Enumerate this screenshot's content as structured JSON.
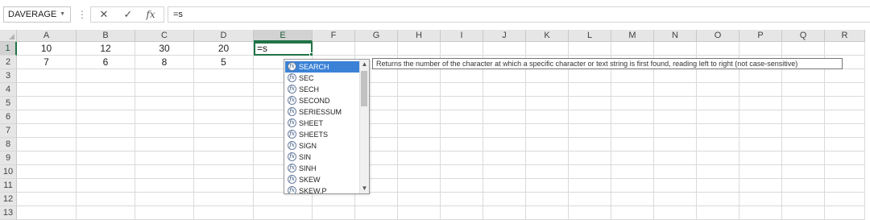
{
  "name_box": {
    "value": "DAVERAGE",
    "dropdown_glyph": "▼"
  },
  "formula_bar": {
    "options_glyph": "⋮",
    "cancel_glyph": "✕",
    "enter_glyph": "✓",
    "fx_glyph": "fx",
    "value": "=s"
  },
  "colors": {
    "accent": "#217346",
    "selection": "#3b82d6"
  },
  "columns": [
    "A",
    "B",
    "C",
    "D",
    "E",
    "F",
    "G",
    "H",
    "I",
    "J",
    "K",
    "L",
    "M",
    "N",
    "O",
    "P",
    "Q",
    "R"
  ],
  "selected_column": "E",
  "selected_row": "1",
  "rows": [
    {
      "label": "1",
      "cells": [
        "10",
        "12",
        "30",
        "20",
        "=s",
        "",
        "",
        "",
        "",
        "",
        "",
        "",
        "",
        "",
        "",
        "",
        "",
        ""
      ]
    },
    {
      "label": "2",
      "cells": [
        "7",
        "6",
        "8",
        "5",
        "",
        "",
        "",
        "",
        "",
        "",
        "",
        "",
        "",
        "",
        "",
        "",
        "",
        ""
      ]
    },
    {
      "label": "3",
      "cells": []
    },
    {
      "label": "4",
      "cells": []
    },
    {
      "label": "5",
      "cells": []
    },
    {
      "label": "6",
      "cells": []
    },
    {
      "label": "7",
      "cells": []
    },
    {
      "label": "8",
      "cells": []
    },
    {
      "label": "9",
      "cells": []
    },
    {
      "label": "10",
      "cells": []
    },
    {
      "label": "11",
      "cells": []
    },
    {
      "label": "12",
      "cells": []
    },
    {
      "label": "13",
      "cells": []
    }
  ],
  "autocomplete": {
    "items": [
      "SEARCH",
      "SEC",
      "SECH",
      "SECOND",
      "SERIESSUM",
      "SHEET",
      "SHEETS",
      "SIGN",
      "SIN",
      "SINH",
      "SKEW",
      "SKEW.P"
    ],
    "selected": "SEARCH",
    "icon": "function-icon",
    "icon_glyph": "fx",
    "scroll_up_glyph": "▲",
    "scroll_down_glyph": "▼",
    "tooltip": "Returns the number of the character at which a specific character or text string is first found, reading left to right (not case-sensitive)"
  }
}
